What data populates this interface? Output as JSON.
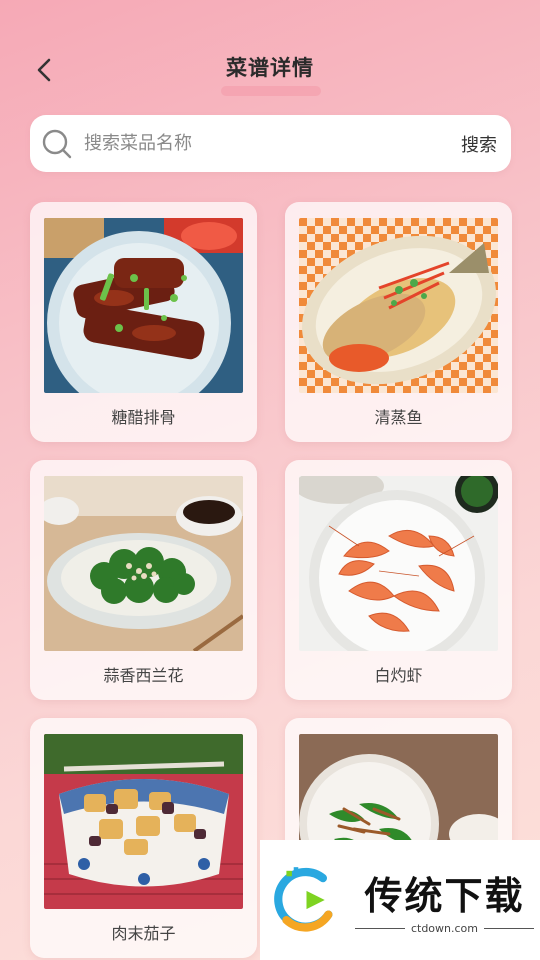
{
  "header": {
    "title": "菜谱详情"
  },
  "search": {
    "placeholder": "搜索菜品名称",
    "button_label": "搜索"
  },
  "recipes": [
    {
      "name": "糖醋排骨"
    },
    {
      "name": "清蒸鱼"
    },
    {
      "name": "蒜香西兰花"
    },
    {
      "name": "白灼虾"
    },
    {
      "name": "肉末茄子"
    },
    {
      "name": ""
    }
  ],
  "watermark": {
    "title": "传统下载",
    "url": "ctdown.com"
  },
  "colors": {
    "accent": "#f4a0ad",
    "background_top": "#f6a9b6",
    "background_bottom": "#fde1da"
  }
}
